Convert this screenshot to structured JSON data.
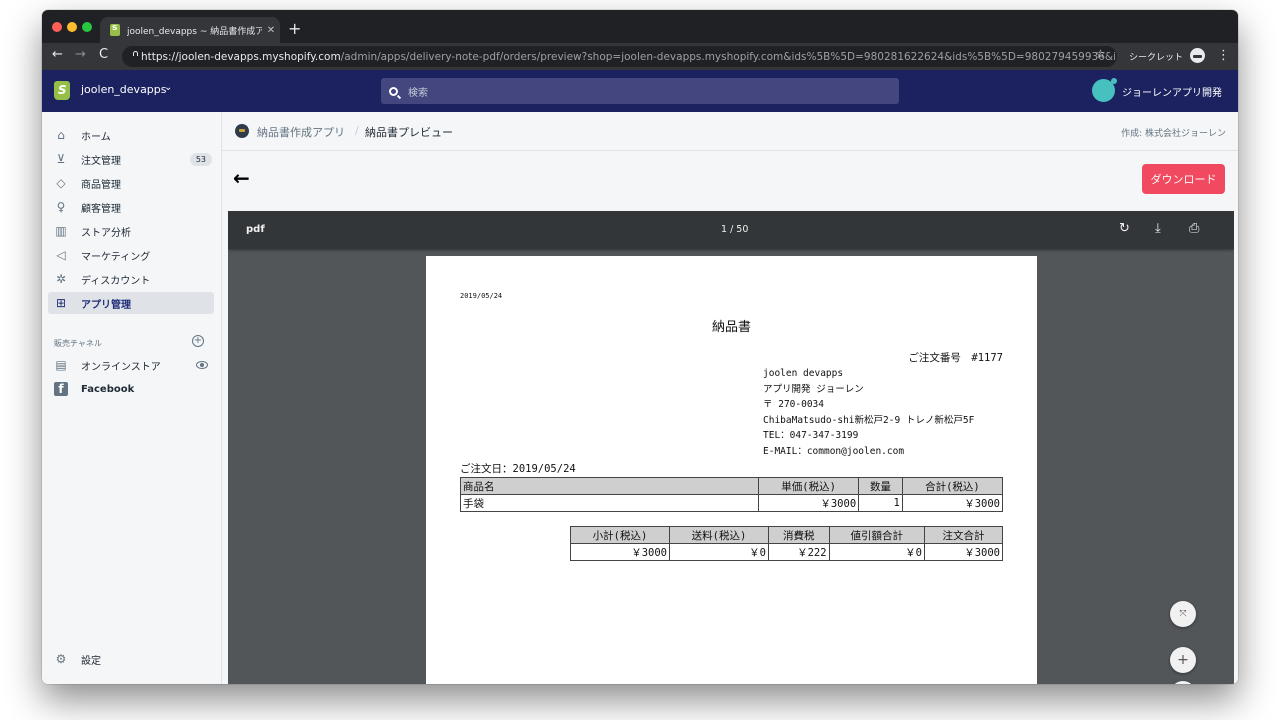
{
  "browser": {
    "tab_title": "joolen_devapps ~ 納品書作成アプ",
    "url_host": "https://joolen-devapps.myshopify.com",
    "url_path": "/admin/apps/delivery-note-pdf/orders/preview?shop=joolen-devapps.myshopify.com&ids%5B%5D=980281622624&ids%5B%5D=980279459936&i...",
    "incognito_label": "シークレット",
    "icons": {
      "back": "←",
      "forward": "→",
      "reload": "C",
      "star": "☆",
      "menu": "⋮",
      "new_tab": "+",
      "close_tab": "✕"
    }
  },
  "topbar": {
    "store_name": "joolen_devapps",
    "search_placeholder": "検索",
    "user_name": "ジョーレンアプリ開発",
    "avatar_color": "#47c1bf",
    "bar_color": "#1c2260"
  },
  "sidebar": {
    "items": [
      {
        "label": "ホーム",
        "icon": "home-icon",
        "glyph": "⌂"
      },
      {
        "label": "注文管理",
        "icon": "orders-icon",
        "glyph": "⊻",
        "badge": "53"
      },
      {
        "label": "商品管理",
        "icon": "tag-icon",
        "glyph": "◇"
      },
      {
        "label": "顧客管理",
        "icon": "customer-icon",
        "glyph": "♀"
      },
      {
        "label": "ストア分析",
        "icon": "analytics-icon",
        "glyph": "▥"
      },
      {
        "label": "マーケティング",
        "icon": "megaphone-icon",
        "glyph": "◁"
      },
      {
        "label": "ディスカウント",
        "icon": "discount-icon",
        "glyph": "✲"
      },
      {
        "label": "アプリ管理",
        "icon": "apps-icon",
        "glyph": "⊞",
        "active": true
      }
    ],
    "channels_label": "販売チャネル",
    "channels": [
      {
        "label": "オンラインストア",
        "icon": "store-icon",
        "glyph": "▤"
      },
      {
        "label": "Facebook",
        "icon": "facebook-icon",
        "glyph": "f"
      }
    ],
    "settings_label": "設定",
    "settings_glyph": "⚙"
  },
  "main": {
    "breadcrumb_app": "納品書作成アプリ",
    "breadcrumb_sep": "/",
    "breadcrumb_current": "納品書プレビュー",
    "author": "作成: 株式会社ジョーレン",
    "back_glyph": "←",
    "download_label": "ダウンロード",
    "download_color": "#f1495f"
  },
  "viewer": {
    "file_name": "pdf",
    "page_indicator": "1 / 50",
    "current_page": 1,
    "total_pages": 50,
    "icons": {
      "rotate": "↻",
      "download": "⤓",
      "print": "⎙",
      "fit": "⤧",
      "zoom_in": "+",
      "zoom_out": "−"
    }
  },
  "document": {
    "date": "2019/05/24",
    "title": "納品書",
    "order_number": "ご注文番号　#1177",
    "address_lines": [
      "joolen devapps",
      "アプリ開発 ジョーレン",
      "〒 270-0034",
      "ChibaMatsudo-shi新松戸2-9 トレノ新松戸5F",
      "TEL：047-347-3199",
      "E-MAIL：common@joolen.com"
    ],
    "order_date": "ご注文日：2019/05/24",
    "items_headers": [
      "商品名",
      "単価(税込)",
      "数量",
      "合計(税込)"
    ],
    "items": [
      {
        "name": "手袋",
        "unit_price": "￥3000",
        "quantity": "1",
        "total": "￥3000"
      }
    ],
    "totals_headers": [
      "小計(税込)",
      "送料(税込)",
      "消費税",
      "値引額合計",
      "注文合計"
    ],
    "totals_values": [
      "￥3000",
      "￥0",
      "￥222",
      "￥0",
      "￥3000"
    ]
  }
}
